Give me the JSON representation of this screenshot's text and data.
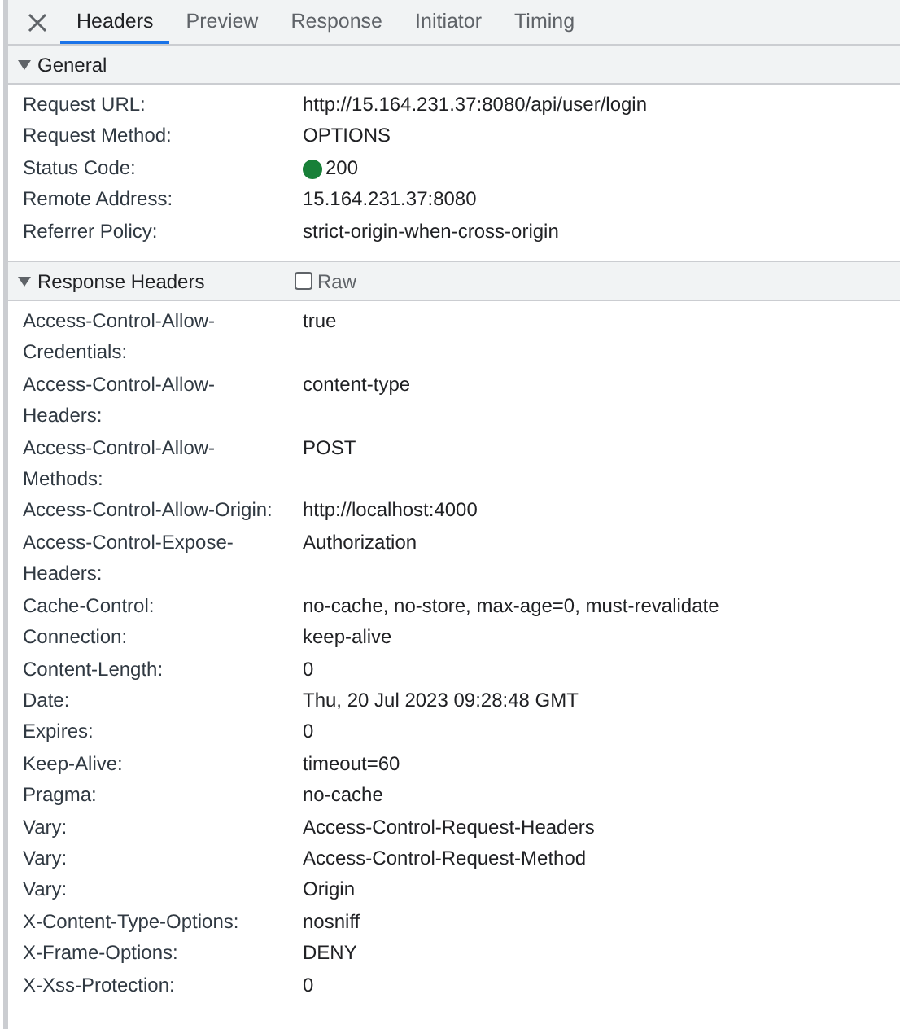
{
  "tabs": [
    {
      "label": "Headers",
      "selected": true
    },
    {
      "label": "Preview",
      "selected": false
    },
    {
      "label": "Response",
      "selected": false
    },
    {
      "label": "Initiator",
      "selected": false
    },
    {
      "label": "Timing",
      "selected": false
    }
  ],
  "sections": [
    {
      "title": "General",
      "expanded": true,
      "rows": [
        {
          "key": "Request URL:",
          "value": "http://15.164.231.37:8080/api/user/login"
        },
        {
          "key": "Request Method:",
          "value": "OPTIONS"
        },
        {
          "key": "Status Code:",
          "value": "200",
          "color": "#188038"
        },
        {
          "key": "Remote Address:",
          "value": "15.164.231.37:8080"
        },
        {
          "key": "Referrer Policy:",
          "value": "strict-origin-when-cross-origin"
        }
      ]
    },
    {
      "title": "Response Headers",
      "expanded": true,
      "raw": {
        "label": "Raw",
        "checked": false
      },
      "rows": [
        {
          "key": "Access-Control-Allow-Credentials:",
          "value": "true"
        },
        {
          "key": "Access-Control-Allow-Headers:",
          "value": "content-type"
        },
        {
          "key": "Access-Control-Allow-Methods:",
          "value": "POST"
        },
        {
          "key": "Access-Control-Allow-Origin:",
          "value": "http://localhost:4000"
        },
        {
          "key": "Access-Control-Expose-Headers:",
          "value": "Authorization"
        },
        {
          "key": "Cache-Control:",
          "value": "no-cache, no-store, max-age=0, must-revalidate"
        },
        {
          "key": "Connection:",
          "value": "keep-alive"
        },
        {
          "key": "Content-Length:",
          "value": "0"
        },
        {
          "key": "Date:",
          "value": "Thu, 20 Jul 2023 09:28:48 GMT"
        },
        {
          "key": "Expires:",
          "value": "0"
        },
        {
          "key": "Keep-Alive:",
          "value": "timeout=60"
        },
        {
          "key": "Pragma:",
          "value": "no-cache"
        },
        {
          "key": "Vary:",
          "value": "Access-Control-Request-Headers"
        },
        {
          "key": "Vary:",
          "value": "Access-Control-Request-Method"
        },
        {
          "key": "Vary:",
          "value": "Origin"
        },
        {
          "key": "X-Content-Type-Options:",
          "value": "nosniff"
        },
        {
          "key": "X-Frame-Options:",
          "value": "DENY"
        },
        {
          "key": "X-Xss-Protection:",
          "value": "0"
        }
      ]
    }
  ]
}
